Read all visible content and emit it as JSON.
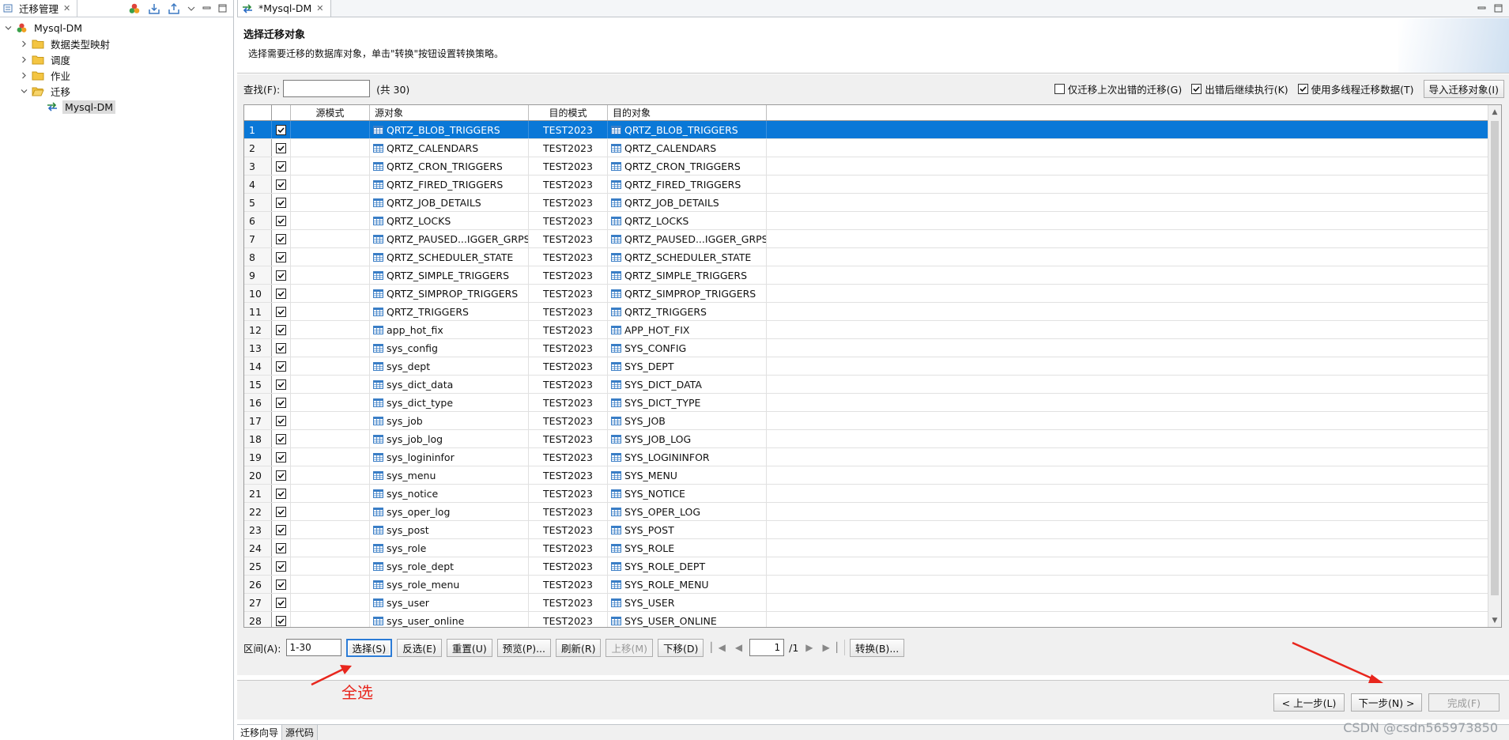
{
  "left_panel": {
    "tab_label": "迁移管理",
    "tree": {
      "root": "Mysql-DM",
      "children": [
        "数据类型映射",
        "调度",
        "作业",
        "迁移"
      ],
      "leaf": "Mysql-DM"
    }
  },
  "editor": {
    "tab_label": "*Mysql-DM",
    "title": "选择迁移对象",
    "description": "选择需要迁移的数据库对象，单击\"转换\"按钮设置转换策略。",
    "search_label": "查找(F):",
    "search_value": "",
    "count": "(共 30)",
    "options": [
      "仅迁移上次出错的迁移(G)",
      "出错后继续执行(K)",
      "使用多线程迁移数据(T)"
    ],
    "import_button": "导入迁移对象(I)",
    "columns": [
      "源模式",
      "源对象",
      "目的模式",
      "目的对象"
    ],
    "rows": [
      {
        "n": "1",
        "src": "QRTZ_BLOB_TRIGGERS",
        "tm": "TEST2023",
        "tgt": "QRTZ_BLOB_TRIGGERS"
      },
      {
        "n": "2",
        "src": "QRTZ_CALENDARS",
        "tm": "TEST2023",
        "tgt": "QRTZ_CALENDARS"
      },
      {
        "n": "3",
        "src": "QRTZ_CRON_TRIGGERS",
        "tm": "TEST2023",
        "tgt": "QRTZ_CRON_TRIGGERS"
      },
      {
        "n": "4",
        "src": "QRTZ_FIRED_TRIGGERS",
        "tm": "TEST2023",
        "tgt": "QRTZ_FIRED_TRIGGERS"
      },
      {
        "n": "5",
        "src": "QRTZ_JOB_DETAILS",
        "tm": "TEST2023",
        "tgt": "QRTZ_JOB_DETAILS"
      },
      {
        "n": "6",
        "src": "QRTZ_LOCKS",
        "tm": "TEST2023",
        "tgt": "QRTZ_LOCKS"
      },
      {
        "n": "7",
        "src": "QRTZ_PAUSED...IGGER_GRPS",
        "tm": "TEST2023",
        "tgt": "QRTZ_PAUSED...IGGER_GRPS"
      },
      {
        "n": "8",
        "src": "QRTZ_SCHEDULER_STATE",
        "tm": "TEST2023",
        "tgt": "QRTZ_SCHEDULER_STATE"
      },
      {
        "n": "9",
        "src": "QRTZ_SIMPLE_TRIGGERS",
        "tm": "TEST2023",
        "tgt": "QRTZ_SIMPLE_TRIGGERS"
      },
      {
        "n": "10",
        "src": "QRTZ_SIMPROP_TRIGGERS",
        "tm": "TEST2023",
        "tgt": "QRTZ_SIMPROP_TRIGGERS"
      },
      {
        "n": "11",
        "src": "QRTZ_TRIGGERS",
        "tm": "TEST2023",
        "tgt": "QRTZ_TRIGGERS"
      },
      {
        "n": "12",
        "src": "app_hot_fix",
        "tm": "TEST2023",
        "tgt": "APP_HOT_FIX"
      },
      {
        "n": "13",
        "src": "sys_config",
        "tm": "TEST2023",
        "tgt": "SYS_CONFIG"
      },
      {
        "n": "14",
        "src": "sys_dept",
        "tm": "TEST2023",
        "tgt": "SYS_DEPT"
      },
      {
        "n": "15",
        "src": "sys_dict_data",
        "tm": "TEST2023",
        "tgt": "SYS_DICT_DATA"
      },
      {
        "n": "16",
        "src": "sys_dict_type",
        "tm": "TEST2023",
        "tgt": "SYS_DICT_TYPE"
      },
      {
        "n": "17",
        "src": "sys_job",
        "tm": "TEST2023",
        "tgt": "SYS_JOB"
      },
      {
        "n": "18",
        "src": "sys_job_log",
        "tm": "TEST2023",
        "tgt": "SYS_JOB_LOG"
      },
      {
        "n": "19",
        "src": "sys_logininfor",
        "tm": "TEST2023",
        "tgt": "SYS_LOGININFOR"
      },
      {
        "n": "20",
        "src": "sys_menu",
        "tm": "TEST2023",
        "tgt": "SYS_MENU"
      },
      {
        "n": "21",
        "src": "sys_notice",
        "tm": "TEST2023",
        "tgt": "SYS_NOTICE"
      },
      {
        "n": "22",
        "src": "sys_oper_log",
        "tm": "TEST2023",
        "tgt": "SYS_OPER_LOG"
      },
      {
        "n": "23",
        "src": "sys_post",
        "tm": "TEST2023",
        "tgt": "SYS_POST"
      },
      {
        "n": "24",
        "src": "sys_role",
        "tm": "TEST2023",
        "tgt": "SYS_ROLE"
      },
      {
        "n": "25",
        "src": "sys_role_dept",
        "tm": "TEST2023",
        "tgt": "SYS_ROLE_DEPT"
      },
      {
        "n": "26",
        "src": "sys_role_menu",
        "tm": "TEST2023",
        "tgt": "SYS_ROLE_MENU"
      },
      {
        "n": "27",
        "src": "sys_user",
        "tm": "TEST2023",
        "tgt": "SYS_USER"
      },
      {
        "n": "28",
        "src": "sys_user_online",
        "tm": "TEST2023",
        "tgt": "SYS_USER_ONLINE"
      }
    ],
    "range_label": "区间(A):",
    "range_value": "1-30",
    "buttons": [
      "选择(S)",
      "反选(E)",
      "重置(U)",
      "预览(P)...",
      "刷新(R)",
      "上移(M)",
      "下移(D)"
    ],
    "page_value": "1",
    "page_total": "/1",
    "convert_button": "转换(B)...",
    "footer_buttons": [
      "< 上一步(L)",
      "下一步(N) >",
      "完成(F)"
    ],
    "bottom_tabs": [
      "迁移向导",
      "源代码"
    ]
  },
  "annotation_text": "全选",
  "watermark": "CSDN @csdn565973850",
  "colors": {
    "selection": "#0a78d7",
    "annotation": "#e8261d",
    "focus": "#2b7bd6"
  }
}
